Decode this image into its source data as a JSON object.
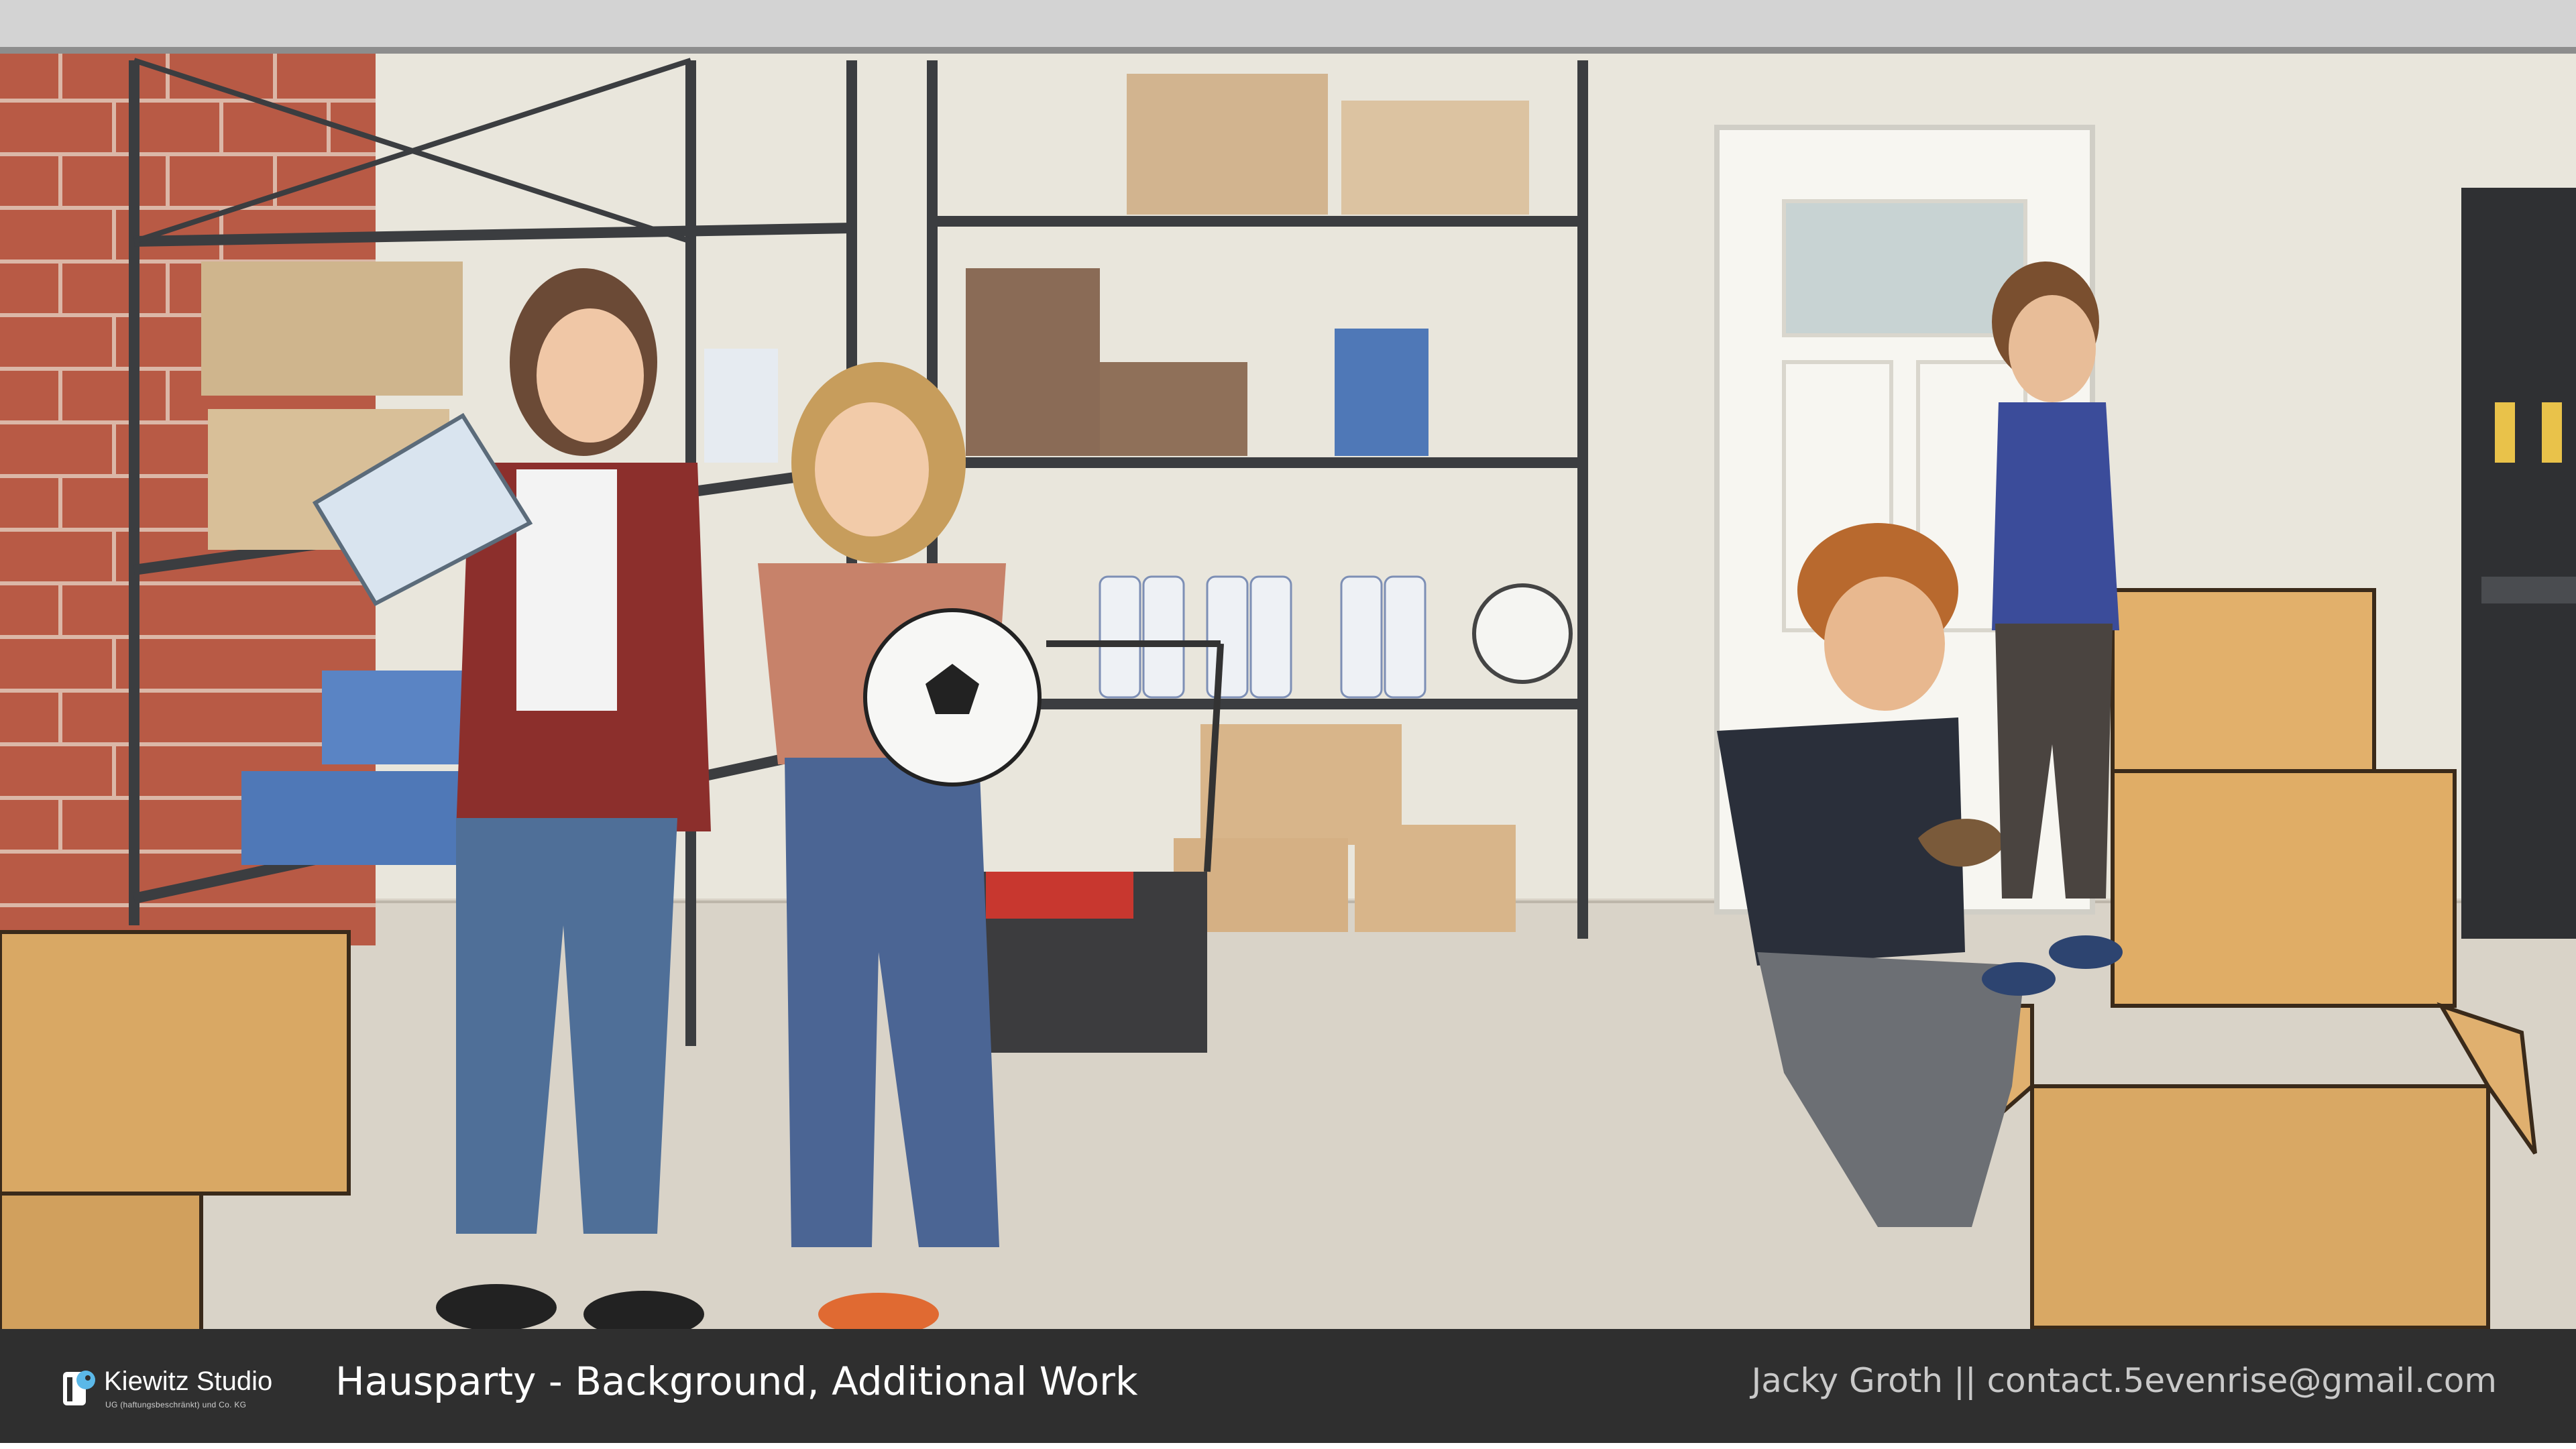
{
  "artwork": {
    "subject": "Illustrated garage storyboard panel: two girls holding a lamp and a soccer ball, a man kneeling with shoes, a boy packing moving boxes",
    "palette": {
      "wall": "#e9e6dc",
      "floor": "#d9d3c8",
      "brick": "#b85a45",
      "cardboard": "#d9a864",
      "shelf_metal": "#3b3d40",
      "bar": "#2f2f2f"
    }
  },
  "caption": {
    "studio_name": "Kiewitz Studio",
    "studio_legal": "UG (haftungsbeschränkt) und Co. KG",
    "title": "Hausparty - Background, Additional Work",
    "credit": "Jacky Groth || contact.5evenrise@gmail.com"
  },
  "icons": {
    "studio_logo": "kiewitz-studio-logo-icon"
  }
}
